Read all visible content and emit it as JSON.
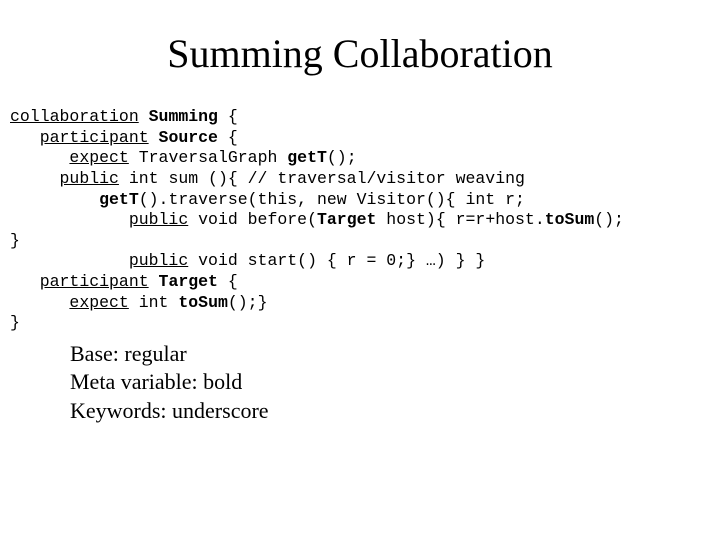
{
  "title": "Summing Collaboration",
  "code": {
    "l1_kw": "collaboration",
    "l1_sp": " ",
    "l1_mv": "Summing",
    "l1_rest": " {",
    "l2_pre": "   ",
    "l2_kw": "participant",
    "l2_sp": " ",
    "l2_mv": "Source",
    "l2_rest": " {",
    "l3_pre": "      ",
    "l3_kw": "expect",
    "l3_mid": " TraversalGraph ",
    "l3_mv": "getT",
    "l3_rest": "();",
    "l4_pre": "     ",
    "l4_kw": "public",
    "l4_rest": " int sum (){ // traversal/visitor weaving",
    "l5_pre": "         ",
    "l5_mv": "getT",
    "l5_rest": "().traverse(this, new Visitor(){ int r;",
    "l6_pre": "            ",
    "l6_kw": "public",
    "l6_mid": " void before(",
    "l6_mv": "Target",
    "l6_mid2": " host){ r=r+host.",
    "l6_mv2": "toSum",
    "l6_rest": "();",
    "l7": "}",
    "l8_pre": "            ",
    "l8_kw": "public",
    "l8_rest": " void start() { r = 0;} …) } }",
    "l9_pre": "   ",
    "l9_kw": "participant",
    "l9_sp": " ",
    "l9_mv": "Target",
    "l9_rest": " {",
    "l10_pre": "      ",
    "l10_kw": "expect",
    "l10_mid": " int ",
    "l10_mv": "toSum",
    "l10_rest": "();}",
    "l11": "}"
  },
  "legend": {
    "line1": "Base: regular",
    "line2": "Meta variable: bold",
    "line3": "Keywords: underscore"
  }
}
